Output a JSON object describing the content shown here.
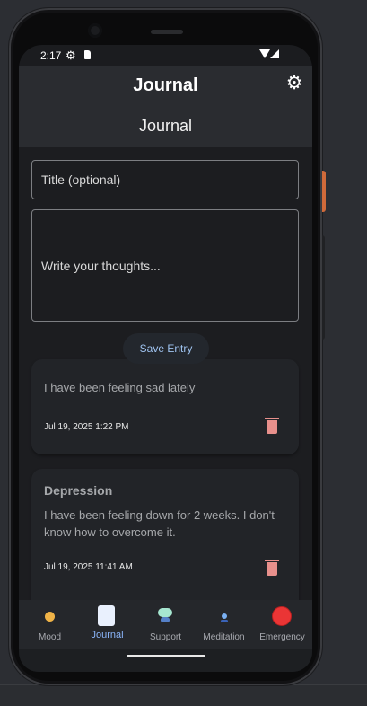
{
  "status_bar": {
    "time": "2:17",
    "gear_icon": "gear-icon",
    "sd_icon": "sd-card-icon",
    "wifi_icon": "wifi-icon",
    "signal_icon": "signal-icon"
  },
  "app_bar": {
    "title": "Journal",
    "settings_icon": "settings-gear-icon"
  },
  "page": {
    "heading": "Journal"
  },
  "form": {
    "title_placeholder": "Title (optional)",
    "title_value": "",
    "body_placeholder": "Write your thoughts...",
    "body_value": "",
    "save_label": "Save Entry"
  },
  "entries": [
    {
      "title": "",
      "body": "I have been feeling sad lately",
      "date": "Jul 19, 2025 1:22 PM"
    },
    {
      "title": "Depression",
      "body": "I have been feeling down for 2 weeks. I don't know how to overcome it.",
      "date": "Jul 19, 2025 11:41 AM"
    }
  ],
  "bottom_nav": [
    {
      "label": "Mood",
      "icon": "mood-icon",
      "active": false
    },
    {
      "label": "Journal",
      "icon": "journal-icon",
      "active": true
    },
    {
      "label": "Support",
      "icon": "support-icon",
      "active": false
    },
    {
      "label": "Meditation",
      "icon": "meditation-icon",
      "active": false
    },
    {
      "label": "Emergency",
      "icon": "emergency-icon",
      "active": false
    }
  ],
  "colors": {
    "accent": "#8ab4f8",
    "delete": "#e8908c",
    "emergency": "#ea3535"
  }
}
